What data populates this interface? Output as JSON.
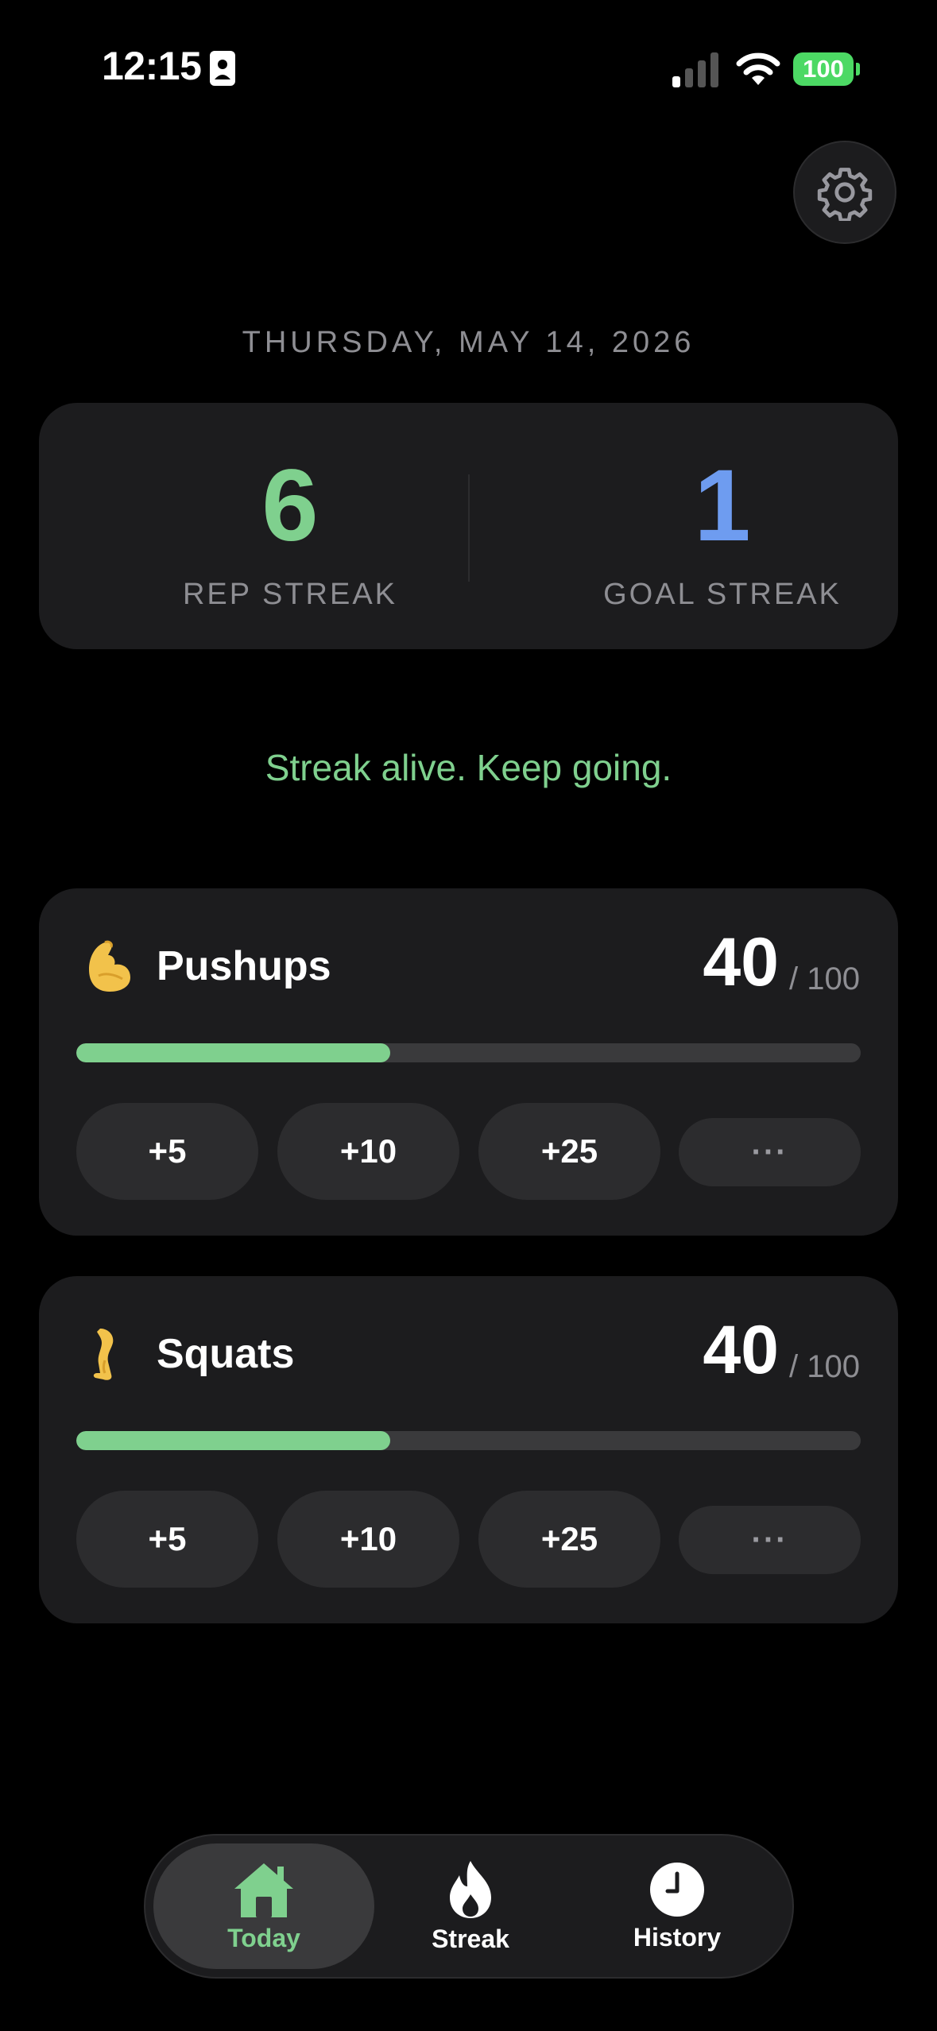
{
  "status_bar": {
    "time": "12:15",
    "battery": "100"
  },
  "date": "THURSDAY, MAY 14, 2026",
  "streaks": {
    "rep": {
      "value": "6",
      "label": "REP STREAK",
      "color": "#7fd08e"
    },
    "goal": {
      "value": "1",
      "label": "GOAL STREAK",
      "color": "#6e9cf0"
    }
  },
  "motivation": "Streak alive. Keep going.",
  "exercises": [
    {
      "emoji": "flexed-biceps-icon",
      "name": "Pushups",
      "count": "40",
      "goal": "/ 100",
      "progress": 0.4,
      "buttons": [
        "+5",
        "+10",
        "+25"
      ],
      "more": "···"
    },
    {
      "emoji": "leg-icon",
      "name": "Squats",
      "count": "40",
      "goal": "/ 100",
      "progress": 0.4,
      "buttons": [
        "+5",
        "+10",
        "+25"
      ],
      "more": "···"
    }
  ],
  "tabs": [
    {
      "label": "Today",
      "icon": "house-icon",
      "active": true
    },
    {
      "label": "Streak",
      "icon": "flame-icon",
      "active": false
    },
    {
      "label": "History",
      "icon": "clock-icon",
      "active": false
    }
  ],
  "colors": {
    "accent_green": "#7fd08e",
    "accent_blue": "#6e9cf0",
    "card": "#1c1c1e"
  }
}
